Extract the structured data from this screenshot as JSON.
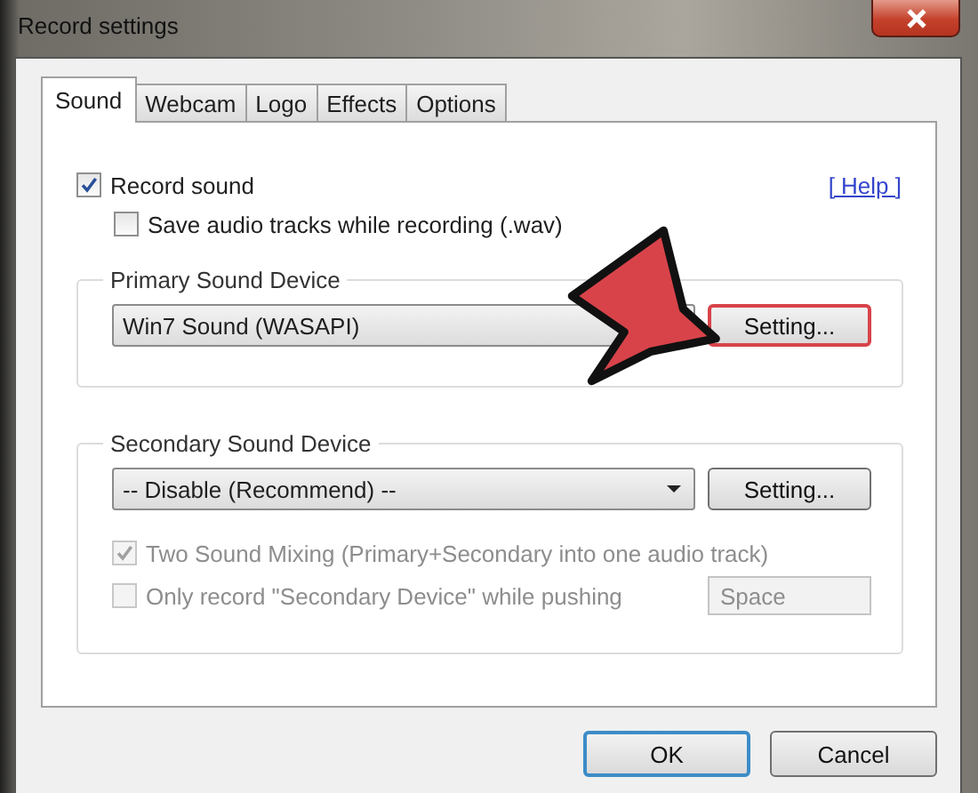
{
  "window": {
    "title": "Record settings"
  },
  "tabs": [
    {
      "label": "Sound",
      "selected": true
    },
    {
      "label": "Webcam",
      "selected": false
    },
    {
      "label": "Logo",
      "selected": false
    },
    {
      "label": "Effects",
      "selected": false
    },
    {
      "label": "Options",
      "selected": false
    }
  ],
  "record_sound": {
    "label": "Record sound",
    "checked": true,
    "disabled": false
  },
  "save_audio": {
    "label": "Save audio tracks while recording (.wav)",
    "checked": false,
    "disabled": false
  },
  "help_link": "[ Help ]",
  "primary": {
    "title": "Primary Sound Device",
    "device": "Win7 Sound (WASAPI)",
    "setting_button": {
      "label": "Setting...",
      "highlighted": true
    }
  },
  "secondary": {
    "title": "Secondary Sound Device",
    "device": "-- Disable (Recommend) --",
    "setting_button": {
      "label": "Setting...",
      "highlighted": false
    },
    "options": [
      {
        "label": "Two Sound Mixing (Primary+Secondary into one audio track)",
        "checked": true,
        "disabled": true
      },
      {
        "label": "Only record \"Secondary Device\" while pushing",
        "checked": false,
        "disabled": true
      }
    ],
    "hotkey": {
      "value": "Space",
      "disabled": true
    }
  },
  "buttons": [
    {
      "label": "OK",
      "default": true
    },
    {
      "label": "Cancel",
      "default": false
    }
  ]
}
